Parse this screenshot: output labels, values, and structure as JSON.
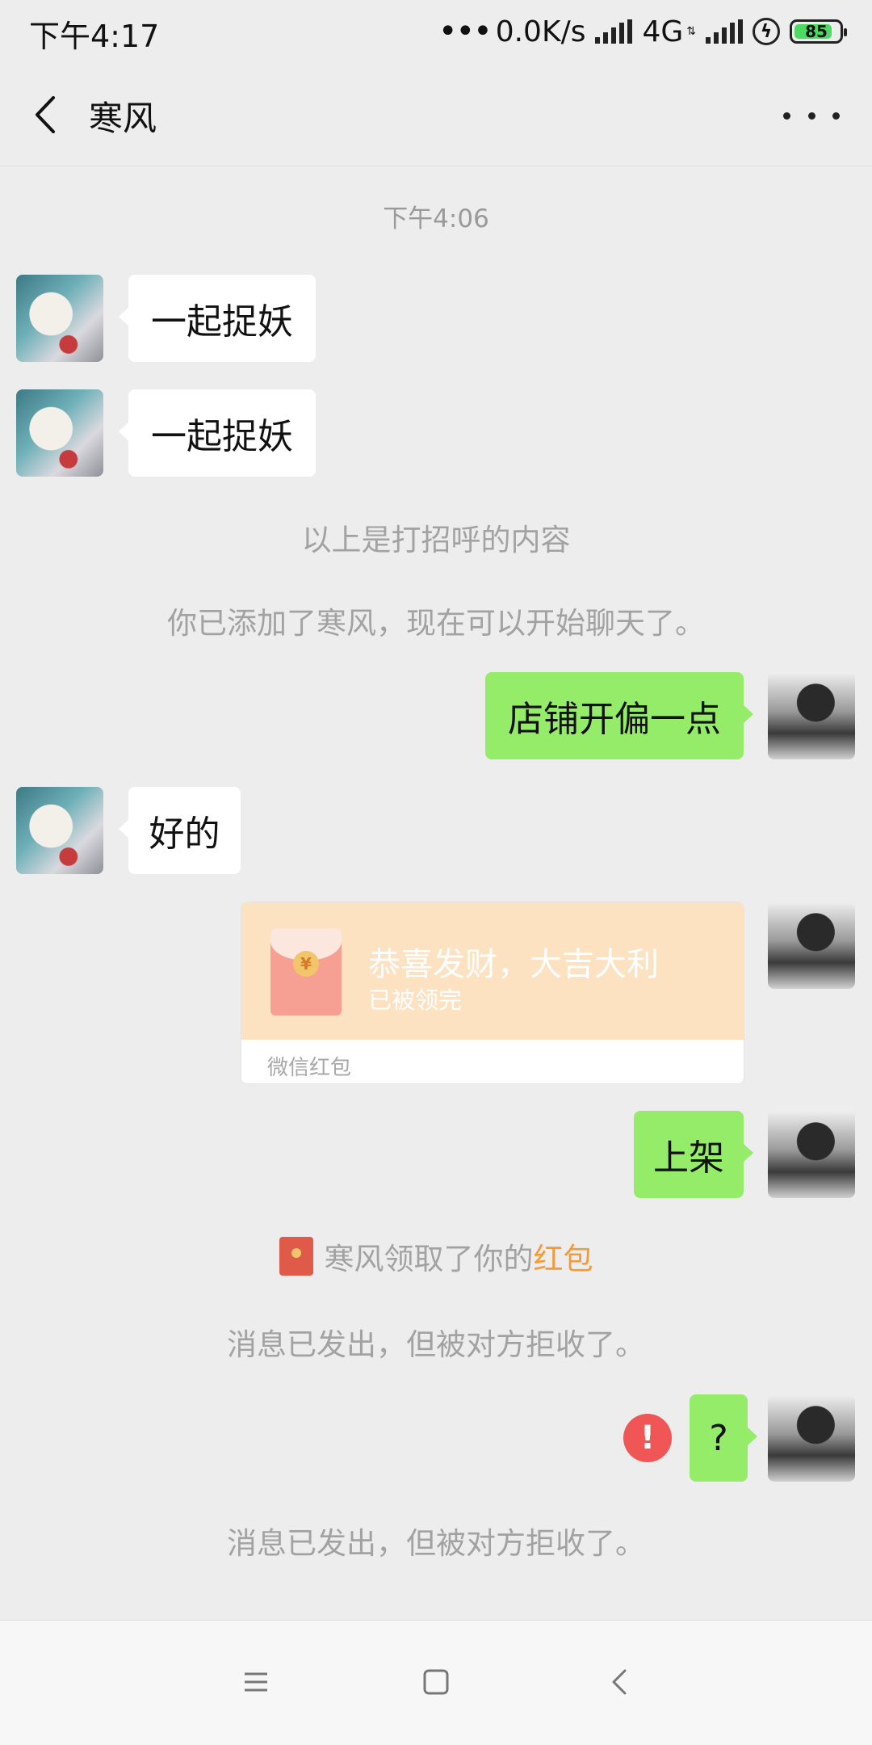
{
  "status_bar": {
    "time": "下午4:17",
    "network_speed": "0.0K/s",
    "network_type": "4G",
    "battery_level": "85",
    "battery_percent": 85
  },
  "header": {
    "title": "寒风",
    "back_icon": "chevron-left-icon",
    "more_icon": "more-dots-icon"
  },
  "chat": {
    "timestamp": "下午4:06",
    "messages": [
      {
        "from": "other",
        "text": "一起捉妖"
      },
      {
        "from": "other",
        "text": "一起捉妖"
      },
      {
        "from": "system",
        "text": "以上是打招呼的内容"
      },
      {
        "from": "system",
        "text": "你已添加了寒风，现在可以开始聊天了。"
      },
      {
        "from": "me",
        "text": "店铺开偏一点"
      },
      {
        "from": "other",
        "text": "好的"
      },
      {
        "from": "me",
        "type": "red_packet",
        "title": "恭喜发财，大吉大利",
        "status": "已被领完",
        "footer": "微信红包"
      },
      {
        "from": "me",
        "text": "上架"
      },
      {
        "from": "system",
        "type": "red_packet_notice",
        "prefix": "寒风领取了你的",
        "link": "红包"
      },
      {
        "from": "system",
        "text": "消息已发出，但被对方拒收了。"
      },
      {
        "from": "me",
        "text": "?",
        "failed": true
      },
      {
        "from": "system",
        "text": "消息已发出，但被对方拒收了。"
      }
    ]
  },
  "colors": {
    "background": "#ededed",
    "my_bubble": "#95ec69",
    "their_bubble": "#ffffff",
    "red_packet": "#fde2c2",
    "error": "#f15656",
    "link": "#f49a36"
  },
  "nav_bar": {
    "icons": [
      "menu-icon",
      "home-square-icon",
      "back-triangle-icon"
    ]
  }
}
